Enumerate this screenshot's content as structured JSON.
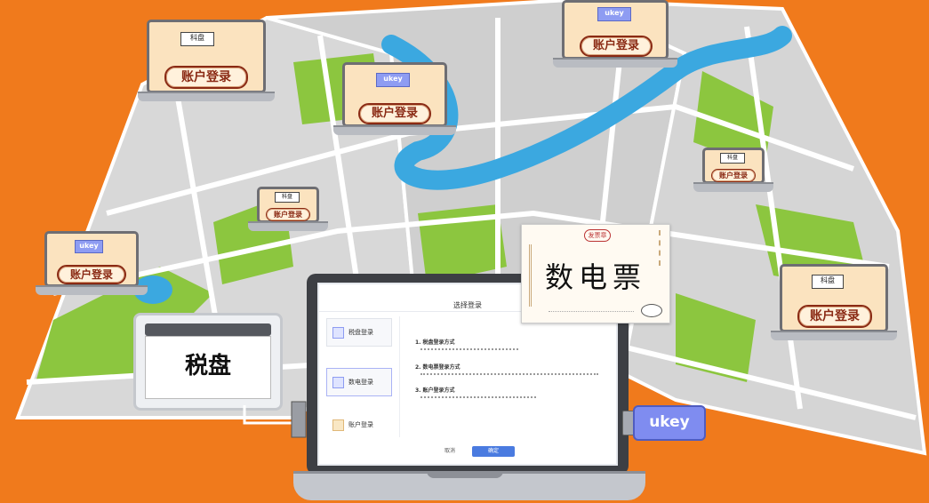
{
  "scene": {
    "login_label": "账户登录",
    "tax_disk_label": "税盘",
    "invoice_label": "数电票",
    "ukey_label": "ukey"
  },
  "laptops": [
    {
      "tag": "科盘",
      "tag_style": "white",
      "badge": "账户登录"
    },
    {
      "tag": "ukey",
      "tag_style": "blue",
      "badge": "账户登录"
    },
    {
      "tag": "ukey",
      "tag_style": "blue",
      "badge": "账户登录"
    },
    {
      "tag": "ukey",
      "tag_style": "blue",
      "badge": "账户登录"
    },
    {
      "tag": "科盘",
      "tag_style": "white",
      "badge": "账户登录"
    },
    {
      "tag": "科盘",
      "tag_style": "white",
      "badge": "账户登录"
    },
    {
      "tag": "科盘",
      "tag_style": "white",
      "badge": "账户登录"
    }
  ],
  "main_screen": {
    "title": "选择登录",
    "sidebar": [
      {
        "label": "税盘登录"
      },
      {
        "label": "数电登录"
      },
      {
        "label": "账户登录"
      }
    ],
    "content_lines": [
      "1. 税盘登录方式",
      "2. 数电票登录方式",
      "3. 账户登录方式"
    ],
    "cancel_label": "取消",
    "confirm_label": "确定"
  },
  "invoice": {
    "seal_text": "发票章"
  },
  "colors": {
    "background": "#f07a1c",
    "map_road": "#d9d9d9",
    "river": "#3ba8e0",
    "park": "#8cc63f",
    "accent_blue": "#7f8cf0"
  }
}
